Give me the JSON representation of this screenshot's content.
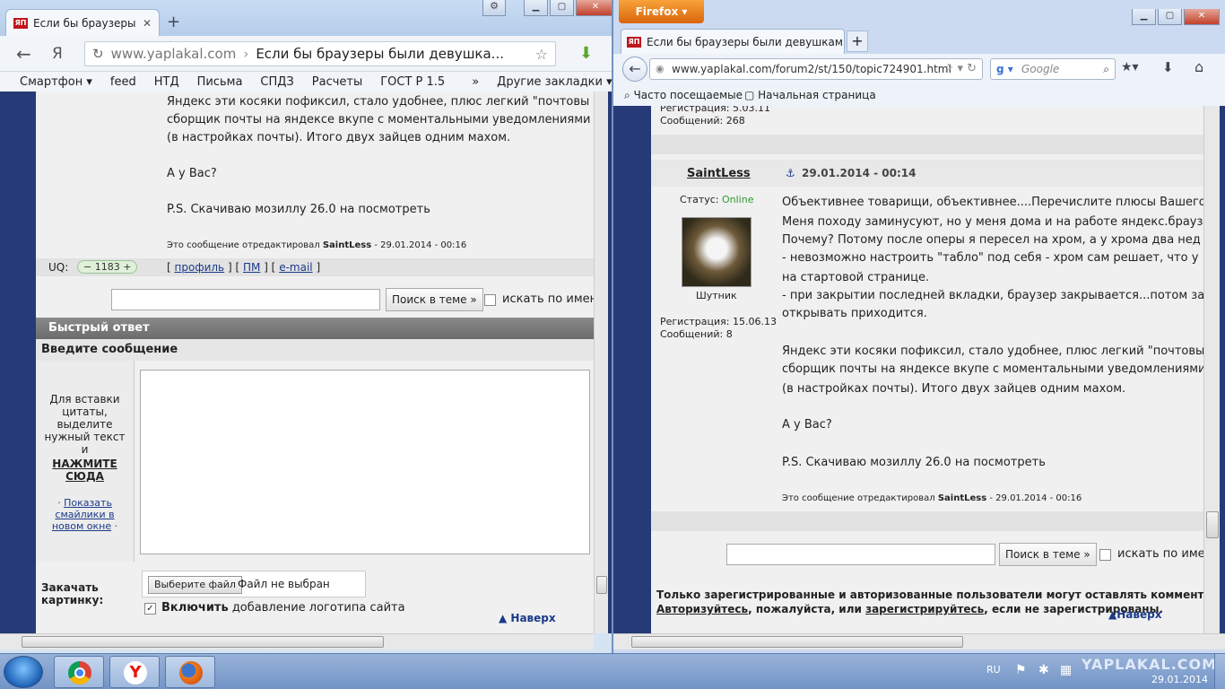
{
  "left_window": {
    "tab_title": "Если бы браузеры бь",
    "tab_favicon": "ЯП",
    "address_host": "www.yaplakal.com",
    "address_separator": "›",
    "address_title": "Если бы браузеры были девушка...",
    "yandex_logo": "Я",
    "bookmarks": [
      "Смартфон ▾",
      "feed",
      "НТД",
      "Письма",
      "СПДЗ",
      "Расчеты",
      "ГОСТ Р 1.5",
      "»",
      "Другие закладки ▾"
    ],
    "post": {
      "lines": [
        "Яндекс эти косяки пофиксил, стало удобнее, плюс легкий \"почтовы",
        "сборщик почты на яндексе вкупе с моментальными уведомлениями",
        "(в настройках почты). Итого двух зайцев одним махом."
      ],
      "question": "А у Вас?",
      "ps": "P.S. Скачиваю мозиллу 26.0 на посмотреть",
      "edited_prefix": "Это сообщение отредактировал ",
      "edited_user": "SaintLess",
      "edited_suffix": " - 29.01.2014 - 00:16"
    },
    "uq": {
      "label": "UQ:",
      "value": "− 1183 +",
      "lb1": "[",
      "profile": "профиль",
      "sep1": "] [",
      "pm": "ПМ",
      "sep2": "] [",
      "email": "e-mail",
      "rb": "]"
    },
    "search": {
      "button": "Поиск в теме »",
      "checkbox_label": "искать по имени"
    },
    "quick_reply": {
      "header": "Быстрый ответ",
      "subheader": "Введите сообщение",
      "side_text": "Для вставки цитаты, выделите нужный текст и",
      "side_link": "НАЖМИТЕ СЮДА",
      "smilies_link": "Показать смайлики в новом окне",
      "upload_label": "Закачать картинку:",
      "file_button": "Выберите файл",
      "file_status": "Файл не выбран",
      "logo_bold": "Включить",
      "logo_text": " добавление логотипа сайта",
      "to_top": "Наверх"
    }
  },
  "right_window": {
    "ff_button": "Firefox ▾",
    "tab_title": "Если бы браузеры были девушками - ...",
    "tab_favicon": "ЯП",
    "new_tab": "+",
    "url": "www.yaplakal.com/forum2/st/150/topic724901.html",
    "search_placeholder": "Google",
    "bookmarks": [
      "Часто посещаемые",
      "Начальная страница"
    ],
    "prev_user_reg": "Регистрация: 5.03.11",
    "prev_user_msgs": "Сообщений: 268",
    "author": "SaintLess",
    "post_date": "29.01.2014 - 00:14",
    "status_label": "Статус: ",
    "status_value": "Online",
    "user_title": "Шутник",
    "user_reg": "Регистрация: 15.06.13",
    "user_msgs": "Сообщений: 8",
    "post_lines": [
      "Объективнее товарищи, объективнее....Перечислите плюсы Вашего",
      "Меня походу заминусуют, но у меня дома и на работе яндекс.брауз",
      "Почему? Потому после оперы я пересел на хром, а у хрома два нед",
      "- невозможно настроить \"табло\" под себя - хром сам решает, что у",
      "на стартовой странице.",
      "- при закрытии последней вкладки, браузер закрывается...потом за",
      "открывать приходится."
    ],
    "post_lines2": [
      "Яндекс эти косяки пофиксил, стало удобнее, плюс легкий \"почтовы",
      "сборщик почты на яндексе вкупе с моментальными уведомлениями",
      "(в настройках почты). Итого двух зайцев одним махом."
    ],
    "question": "А у Вас?",
    "ps": "P.S. Скачиваю мозиллу 26.0 на посмотреть",
    "edited_prefix": "Это сообщение отредактировал ",
    "edited_user": "SaintLess",
    "edited_suffix": " - 29.01.2014 - 00:16",
    "search_button": "Поиск в теме »",
    "search_checkbox_label": "искать по имени",
    "notice": "Только зарегистрированные и авторизованные пользователи могут оставлять комментар",
    "notice2_link1": "Авторизуйтесь",
    "notice2_mid": ", пожалуйста, или ",
    "notice2_link2": "зарегистрируйтесь",
    "notice2_end": ", если не зарегистрированы.",
    "to_top": "Наверх"
  },
  "taskbar": {
    "lang": "RU",
    "date": "29.01.2014",
    "watermark": "YAPLAKAL.COM"
  },
  "colors": {
    "page_bg": "#253a77",
    "post_bg": "#f0f0f0",
    "link": "#1a3a8a",
    "online": "#2e9a2e",
    "firefox_orange": "#e67a1a"
  }
}
